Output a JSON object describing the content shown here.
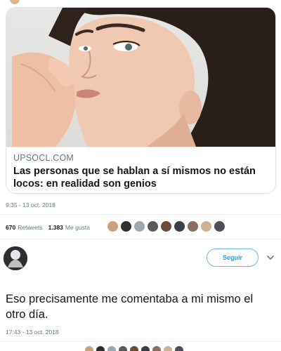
{
  "tweet": {
    "card": {
      "domain": "UPSOCL.COM",
      "title": "Las personas que se hablan a sí mismos no están locos: en realidad son genios"
    },
    "timestamp": "9:35 - 13 oct. 2018",
    "stats": {
      "retweets_count": "670",
      "retweets_label": "Retweets",
      "likes_count": "1.383",
      "likes_label": "Me gusta"
    },
    "liker_colors": [
      "#caa37e",
      "#2f2f2f",
      "#9ea7b0",
      "#5a5a5a",
      "#6b4a3a",
      "#3a3f45",
      "#8a7060",
      "#c9b394",
      "#4d5157"
    ]
  },
  "reply": {
    "follow_label": "Seguir",
    "text": "Eso precisamente me comentaba a mi mismo el otro día.",
    "timestamp": "17:43 - 13 oct. 2018"
  },
  "colors": {
    "accent": "#1da1f2",
    "secondary_text": "#657786"
  }
}
